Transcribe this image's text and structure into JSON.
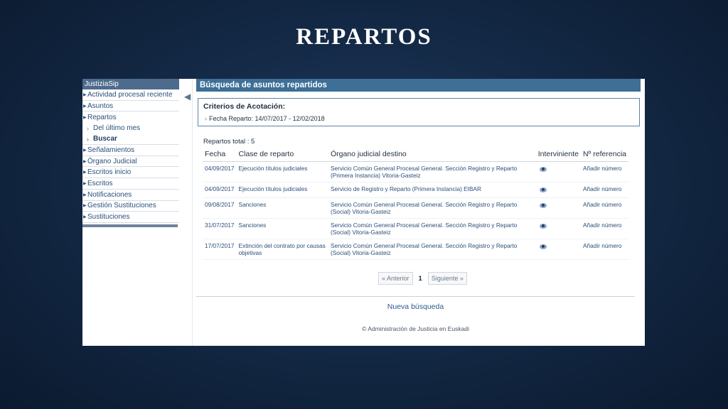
{
  "slide": {
    "title": "REPARTOS"
  },
  "sidebar": {
    "app_title": "JustiziaSip",
    "items": [
      {
        "label": "Actividad procesal reciente"
      },
      {
        "label": "Asuntos"
      },
      {
        "label": "Repartos"
      },
      {
        "label": "Señalamientos"
      },
      {
        "label": "Órgano Judicial"
      },
      {
        "label": "Escritos inicio"
      },
      {
        "label": "Escritos"
      },
      {
        "label": "Notificaciones"
      },
      {
        "label": "Gestión Sustituciones"
      },
      {
        "label": "Sustituciones"
      }
    ],
    "sub_items": [
      {
        "label": "Del último mes"
      },
      {
        "label": "Buscar"
      }
    ]
  },
  "main": {
    "header": "Búsqueda de asuntos repartidos",
    "criteria": {
      "title": "Criterios de Acotación:",
      "line": "Fecha Reparto: 14/07/2017 - 12/02/2018"
    },
    "total": "Repartos total : 5",
    "columns": [
      "Fecha",
      "Clase de reparto",
      "Órgano judicial destino",
      "Interviniente",
      "Nº referencia"
    ],
    "rows": [
      {
        "fecha": "04/09/2017",
        "clase": "Ejecución títulos judiciales",
        "organo": "Servicio Común General Procesal General. Sección Registro y Reparto (Primera Instancia) Vitoria-Gasteiz",
        "ref": "Añadir número"
      },
      {
        "fecha": "04/09/2017",
        "clase": "Ejecución títulos judiciales",
        "organo": "Servicio de Registro y Reparto (Primera Instancia) EIBAR",
        "ref": "Añadir número"
      },
      {
        "fecha": "09/08/2017",
        "clase": "Sanciones",
        "organo": "Servicio Común General Procesal General. Sección Registro y Reparto (Social) Vitoria-Gasteiz",
        "ref": "Añadir número"
      },
      {
        "fecha": "31/07/2017",
        "clase": "Sanciones",
        "organo": "Servicio Común General Procesal General. Sección Registro y Reparto (Social) Vitoria-Gasteiz",
        "ref": "Añadir número"
      },
      {
        "fecha": "17/07/2017",
        "clase": "Extinción del contrato por causas objetivas",
        "organo": "Servicio Común General Procesal General. Sección Registro y Reparto (Social) Vitoria-Gasteiz",
        "ref": "Añadir número"
      }
    ],
    "pager": {
      "prev": "« Anterior",
      "page": "1",
      "next": "Siguiente »"
    },
    "new_search": "Nueva búsqueda",
    "footer": "© Administración de Justicia en Euskadi"
  }
}
